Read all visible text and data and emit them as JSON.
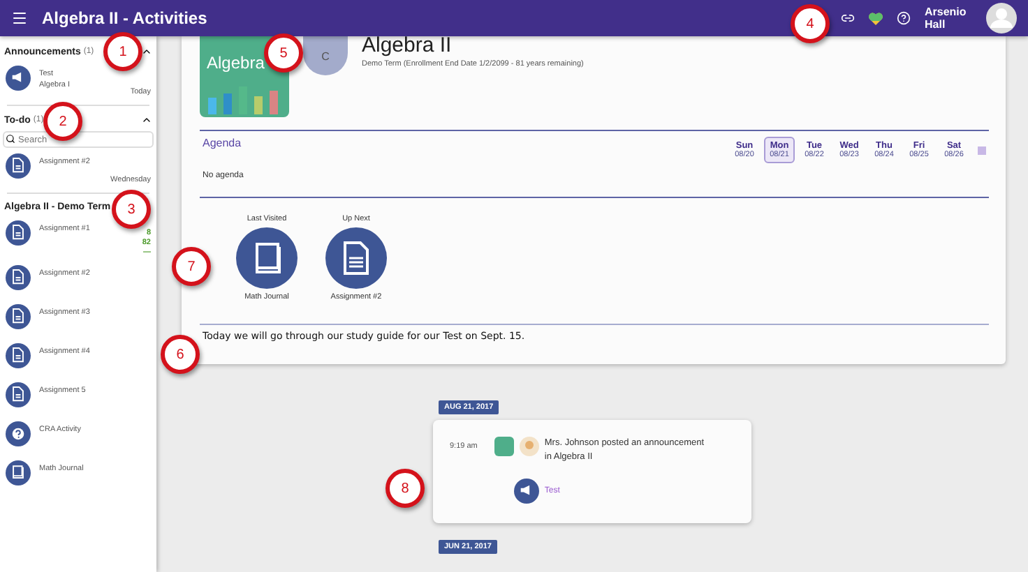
{
  "header": {
    "title": "Algebra II - Activities",
    "user_name": "Arsenio Hall"
  },
  "announcements": {
    "title": "Announcements",
    "count": "(1)",
    "expanded": true,
    "items": [
      {
        "kind": "announcement",
        "title": "Test",
        "subtitle": "Algebra I",
        "date": "Today"
      }
    ]
  },
  "todo": {
    "title": "To-do",
    "count": "(1)",
    "expanded": true,
    "search": {
      "placeholder": "Search"
    },
    "items": [
      {
        "kind": "document",
        "title": "Assignment #2",
        "date": "Wednesday"
      }
    ]
  },
  "course_list": {
    "title": "Algebra II - Demo Term",
    "items": [
      {
        "kind": "document",
        "title": "Assignment #1",
        "grades": [
          "8",
          "82",
          "—"
        ]
      },
      {
        "kind": "document",
        "title": "Assignment #2"
      },
      {
        "kind": "document",
        "title": "Assignment #3"
      },
      {
        "kind": "document",
        "title": "Assignment #4"
      },
      {
        "kind": "document",
        "title": "Assignment 5"
      },
      {
        "kind": "question",
        "title": "CRA Activity"
      },
      {
        "kind": "book",
        "title": "Math Journal"
      }
    ]
  },
  "course": {
    "title": "Algebra II",
    "image_text": "Algebra",
    "avatar_letter": "C",
    "subtitle": "Demo Term (Enrollment End Date 1/2/2099 - 81 years remaining)"
  },
  "agenda": {
    "title": "Agenda",
    "empty_text": "No agenda",
    "days": [
      {
        "day": "Sun",
        "date": "08/20",
        "selected": false
      },
      {
        "day": "Mon",
        "date": "08/21",
        "selected": true
      },
      {
        "day": "Tue",
        "date": "08/22",
        "selected": false
      },
      {
        "day": "Wed",
        "date": "08/23",
        "selected": false
      },
      {
        "day": "Thu",
        "date": "08/24",
        "selected": false
      },
      {
        "day": "Fri",
        "date": "08/25",
        "selected": false
      },
      {
        "day": "Sat",
        "date": "08/26",
        "selected": false
      }
    ]
  },
  "quick_links": [
    {
      "kind": "book",
      "label": "Last Visited",
      "name": "Math Journal"
    },
    {
      "kind": "document",
      "label": "Up Next",
      "name": "Assignment #2"
    }
  ],
  "note": "Today we will go through our study guide for our Test on Sept. 15.",
  "timeline": [
    {
      "date": "AUG 21, 2017",
      "time": "9:19 am",
      "message": "Mrs. Johnson posted an announcement in Algebra II",
      "link": "Test"
    },
    {
      "date": "JUN 21, 2017"
    }
  ],
  "callouts": [
    "1",
    "2",
    "3",
    "4",
    "5",
    "6",
    "7",
    "8"
  ]
}
